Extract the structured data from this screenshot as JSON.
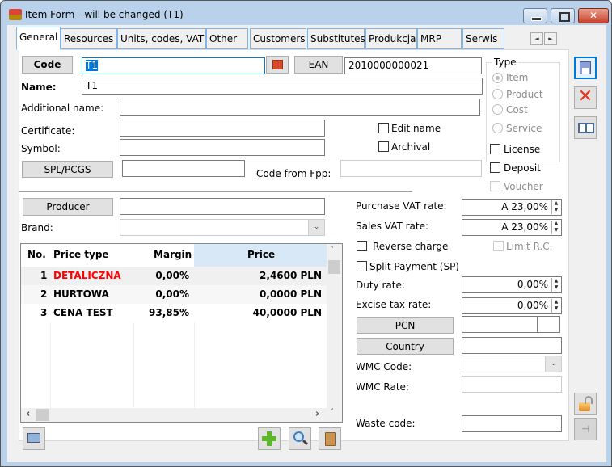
{
  "window": {
    "title": "Item Form - will be changed (T1)",
    "close_glyph": "✕"
  },
  "tabs": [
    {
      "label": "General",
      "active": true
    },
    {
      "label": "Resources"
    },
    {
      "label": "Units, codes, VAT"
    },
    {
      "label": "Other"
    },
    {
      "label": "Customers"
    },
    {
      "label": "Substitutes"
    },
    {
      "label": "Produkcja"
    },
    {
      "label": "MRP"
    },
    {
      "label": "Serwis"
    }
  ],
  "tab_scroll": {
    "left": "◄",
    "right": "►"
  },
  "form": {
    "code_button": "Code",
    "code_value": "T1",
    "ean_button": "EAN",
    "ean_value": "2010000000021",
    "name_label": "Name:",
    "name_value": "T1",
    "additional_name_label": "Additional name:",
    "additional_name_value": "",
    "certificate_label": "Certificate:",
    "certificate_value": "",
    "symbol_label": "Symbol:",
    "symbol_value": "",
    "spl_button": "SPL/PCGS",
    "spl_value": "",
    "code_from_fpp_label": "Code from Fpp:",
    "code_from_fpp_value": "",
    "edit_name_label": "Edit name",
    "edit_name_checked": false,
    "archival_label": "Archival",
    "archival_checked": false,
    "producer_button": "Producer",
    "producer_value": "",
    "brand_label": "Brand:",
    "brand_value": ""
  },
  "type_group": {
    "title": "Type",
    "options": [
      {
        "label": "Item",
        "selected": true
      },
      {
        "label": "Product",
        "selected": false
      },
      {
        "label": "Cost",
        "selected": false
      },
      {
        "label": "Service",
        "selected": false
      }
    ]
  },
  "flags": {
    "license": "License",
    "deposit": "Deposit",
    "voucher": "Voucher"
  },
  "price_grid": {
    "columns": [
      "No.",
      "Price type",
      "Margin",
      "Price"
    ],
    "rows": [
      {
        "no": "1",
        "type": "DETALICZNA",
        "margin": "0,00%",
        "price": "2,4600 PLN",
        "highlight": true
      },
      {
        "no": "2",
        "type": "HURTOWA",
        "margin": "0,00%",
        "price": "0,0000 PLN"
      },
      {
        "no": "3",
        "type": "CENA TEST",
        "margin": "93,85%",
        "price": "40,0000 PLN"
      }
    ],
    "highlight_color": "#ff0000"
  },
  "vat": {
    "purchase_label": "Purchase VAT rate:",
    "purchase_value": "A 23,00%",
    "sales_label": "Sales VAT rate:",
    "sales_value": "A 23,00%",
    "reverse_charge_label": "Reverse charge",
    "limit_rc_label": "Limit R.C.",
    "split_payment_label": "Split Payment (SP)",
    "duty_label": "Duty rate:",
    "duty_value": "0,00%",
    "excise_label": "Excise tax rate:",
    "excise_value": "0,00%",
    "pcn_button": "PCN",
    "pcn_value": "",
    "country_button": "Country",
    "country_value": "",
    "wmc_code_label": "WMC Code:",
    "wmc_code_value": "",
    "wmc_rate_label": "WMC Rate:",
    "wmc_rate_value": "",
    "waste_code_label": "Waste code:",
    "waste_code_value": ""
  },
  "icons": {
    "spin_up": "▲",
    "spin_down": "▼",
    "dropdown": "⌄",
    "scroll_left": "‹",
    "scroll_right": "›",
    "scroll_up": "˄",
    "scroll_down": "˅"
  }
}
